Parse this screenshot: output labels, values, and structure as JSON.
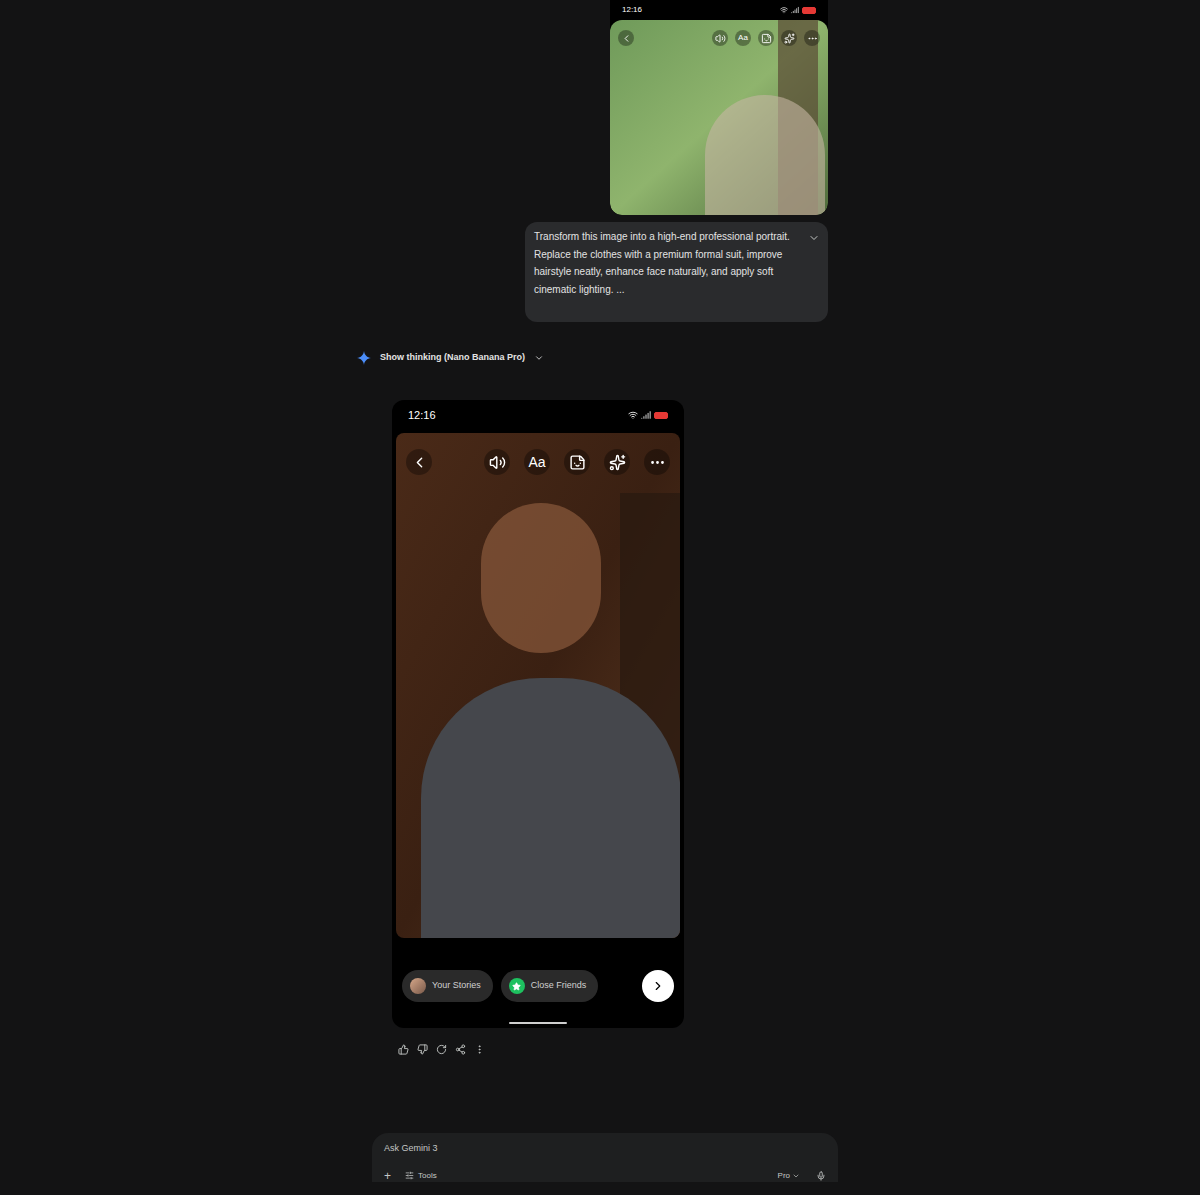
{
  "user_message": {
    "image": {
      "time": "12:16",
      "text_tool": "Aa"
    },
    "text": "Transform this image into a high-end professional portrait.\nReplace the clothes with a premium formal suit, improve hairstyle neatly, enhance face naturally, and apply soft cinematic lighting. ...",
    "expanded": false
  },
  "response": {
    "thinking_label": "Show thinking (Nano Banana Pro)",
    "image": {
      "time": "12:16",
      "text_tool": "Aa",
      "story_targets": [
        {
          "label": "Your Stories",
          "kind": "avatar"
        },
        {
          "label": "Close Friends",
          "kind": "star"
        }
      ]
    }
  },
  "input": {
    "placeholder": "Ask Gemini 3",
    "plus": "+",
    "tools_label": "Tools",
    "model": "Pro"
  }
}
